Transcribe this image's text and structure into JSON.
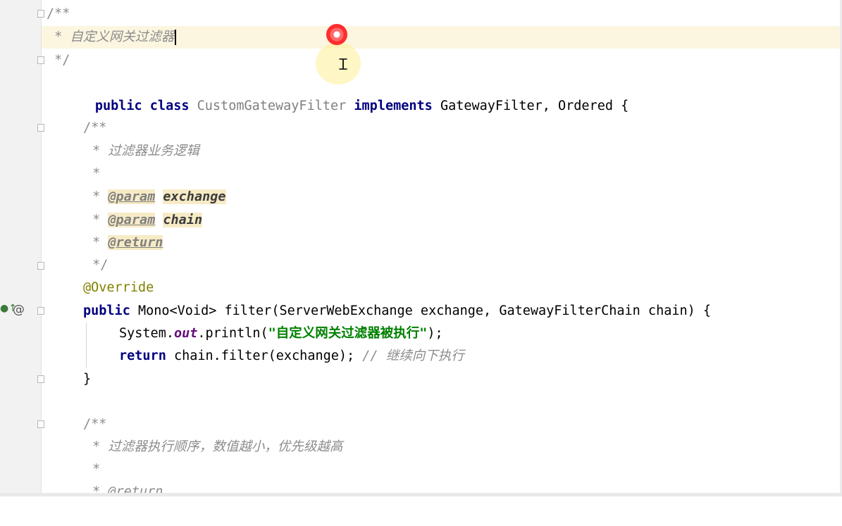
{
  "code": {
    "comment_open": "/**",
    "class_comment": " * 自定义网关过滤器",
    "comment_close": " */",
    "class_decl": {
      "kw_public": "public",
      "kw_class": "class",
      "class_name": "CustomGatewayFilter",
      "kw_implements": "implements",
      "interfaces": "GatewayFilter, Ordered {"
    },
    "filter_doc": {
      "open": "/**",
      "desc": " * 过滤器业务逻辑",
      "blank": " *",
      "param_tag": "@param",
      "param1": "exchange",
      "param2": "chain",
      "return_tag": "@return",
      "star_prefix": " * ",
      "close": " */"
    },
    "override": "@Override",
    "filter_sig": {
      "kw_public": "public",
      "rest": "Mono<Void> filter(ServerWebExchange exchange, GatewayFilterChain chain) {"
    },
    "println": {
      "prefix": "System.",
      "out": "out",
      "call": ".println(",
      "string": "\"自定义网关过滤器被执行\"",
      "end": ");"
    },
    "return_line": {
      "kw_return": "return",
      "expr": "chain.filter(exchange); ",
      "comment": "// 继续向下执行"
    },
    "close_brace": "}",
    "order_doc": {
      "open": "/**",
      "desc": " * 过滤器执行顺序，数值越小，优先级越高",
      "blank": " *",
      "return_partial": " * @return"
    }
  },
  "gutter": {
    "marker_icon": "override-arrow-icon",
    "marker_at": "@"
  },
  "colors": {
    "keyword": "#000080",
    "comment": "#8c8c8c",
    "string": "#008000",
    "annotation": "#808000",
    "current_line": "#fcf6e0"
  }
}
